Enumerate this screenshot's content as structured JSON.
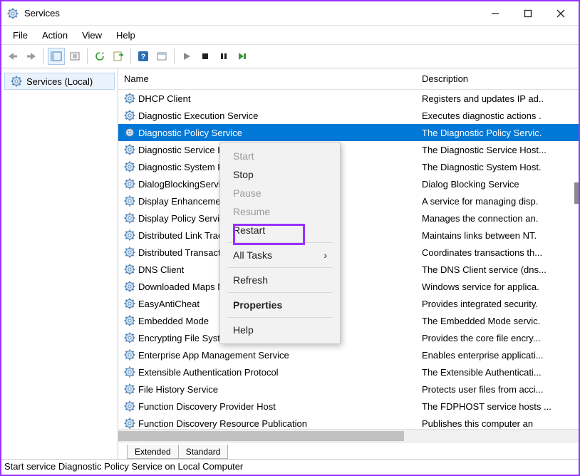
{
  "window": {
    "title": "Services"
  },
  "menubar": [
    "File",
    "Action",
    "View",
    "Help"
  ],
  "tree": {
    "root": "Services (Local)"
  },
  "columns": {
    "name": "Name",
    "desc": "Description"
  },
  "selected_index": 2,
  "services": [
    {
      "name": "DHCP Client",
      "desc": "Registers and updates IP ad.."
    },
    {
      "name": "Diagnostic Execution Service",
      "desc": "Executes diagnostic actions ."
    },
    {
      "name": "Diagnostic Policy Service",
      "desc": "The Diagnostic Policy Servic."
    },
    {
      "name": "Diagnostic Service Host",
      "desc": "The Diagnostic Service Host..."
    },
    {
      "name": "Diagnostic System Host",
      "desc": "The Diagnostic System Host."
    },
    {
      "name": "DialogBlockingService",
      "desc": "Dialog Blocking Service"
    },
    {
      "name": "Display Enhancement Service",
      "desc": "A service for managing disp."
    },
    {
      "name": "Display Policy Service",
      "desc": "Manages the connection an."
    },
    {
      "name": "Distributed Link Tracking Client",
      "desc": "Maintains links between NT."
    },
    {
      "name": "Distributed Transaction Coordinator",
      "desc": "Coordinates transactions th..."
    },
    {
      "name": "DNS Client",
      "desc": "The DNS Client service (dns..."
    },
    {
      "name": "Downloaded Maps Manager",
      "desc": "Windows service for applica."
    },
    {
      "name": "EasyAntiCheat",
      "desc": "Provides integrated security."
    },
    {
      "name": "Embedded Mode",
      "desc": "The Embedded Mode servic."
    },
    {
      "name": "Encrypting File System (EFS)",
      "desc": "Provides the core file encry..."
    },
    {
      "name": "Enterprise App Management Service",
      "desc": "Enables enterprise applicati..."
    },
    {
      "name": "Extensible Authentication Protocol",
      "desc": "The Extensible Authenticati..."
    },
    {
      "name": "File History Service",
      "desc": "Protects user files from acci..."
    },
    {
      "name": "Function Discovery Provider Host",
      "desc": "The FDPHOST service hosts ..."
    },
    {
      "name": "Function Discovery Resource Publication",
      "desc": "Publishes this computer an"
    }
  ],
  "context_menu": {
    "items": [
      {
        "label": "Start",
        "enabled": false
      },
      {
        "label": "Stop",
        "enabled": true
      },
      {
        "label": "Pause",
        "enabled": false
      },
      {
        "label": "Resume",
        "enabled": false
      },
      {
        "label": "Restart",
        "enabled": true,
        "highlight": true
      },
      {
        "sep": true
      },
      {
        "label": "All Tasks",
        "enabled": true,
        "submenu": true
      },
      {
        "sep": true
      },
      {
        "label": "Refresh",
        "enabled": true
      },
      {
        "sep": true
      },
      {
        "label": "Properties",
        "enabled": true,
        "bold": true
      },
      {
        "sep": true
      },
      {
        "label": "Help",
        "enabled": true
      }
    ]
  },
  "tabs": [
    "Extended",
    "Standard"
  ],
  "status": "Start service Diagnostic Policy Service on Local Computer"
}
